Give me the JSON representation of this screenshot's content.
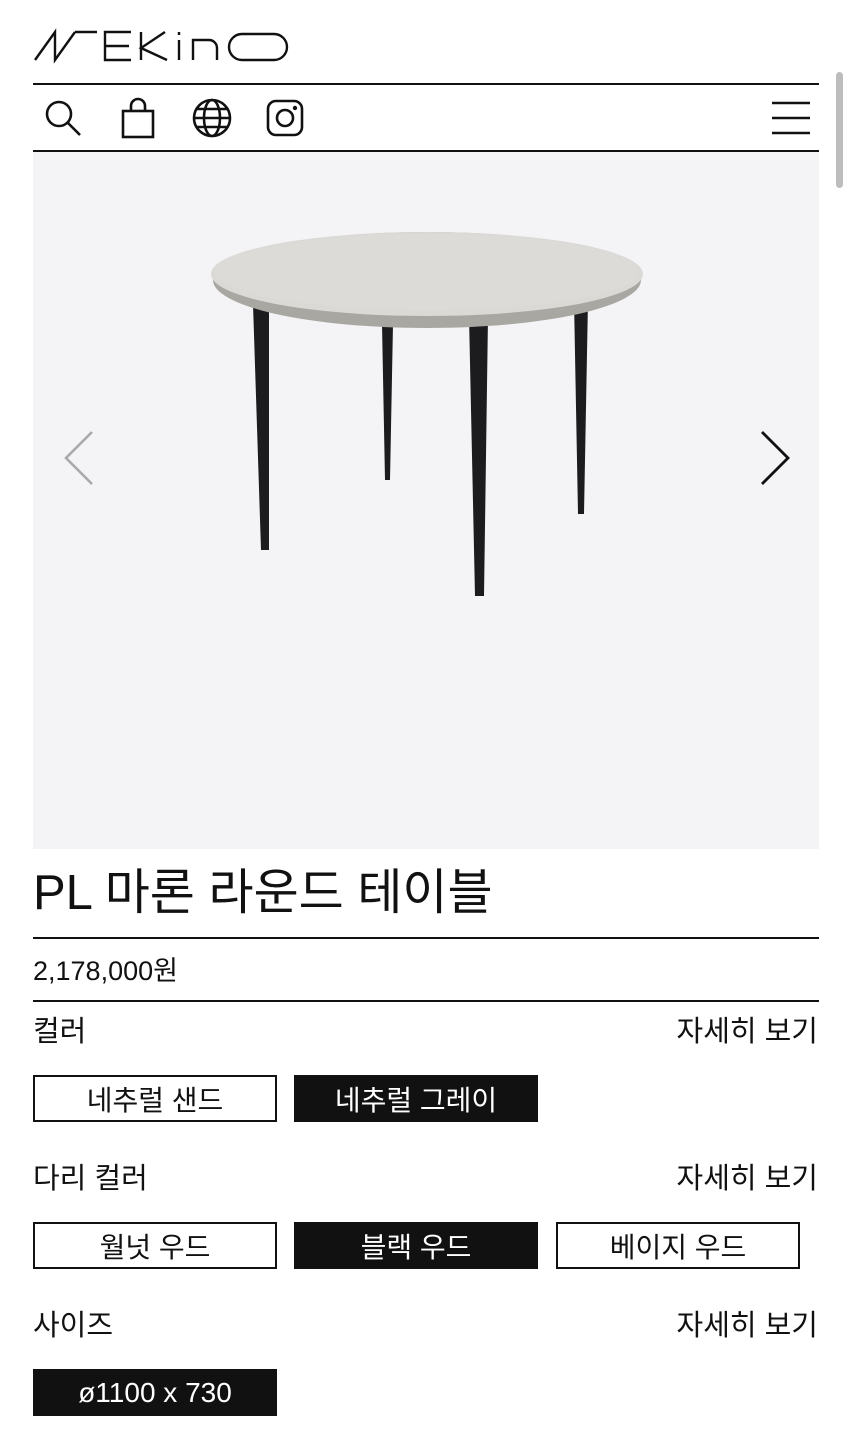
{
  "header": {
    "brand": "WEKINO",
    "icons": [
      "search-icon",
      "shopping-bag-icon",
      "globe-icon",
      "instagram-icon",
      "menu-icon"
    ]
  },
  "gallery": {
    "image_alt": "PL 마론 라운드 테이블",
    "prev_icon": "chevron-left-icon",
    "next_icon": "chevron-right-icon"
  },
  "product": {
    "title": "PL 마론 라운드 테이블",
    "price": "2,178,000원"
  },
  "options": {
    "color": {
      "label": "컬러",
      "more": "자세히 보기",
      "choices": [
        {
          "label": "네추럴 샌드",
          "selected": false
        },
        {
          "label": "네추럴 그레이",
          "selected": true
        }
      ]
    },
    "leg_color": {
      "label": "다리 컬러",
      "more": "자세히 보기",
      "choices": [
        {
          "label": "월넛 우드",
          "selected": false
        },
        {
          "label": "블랙 우드",
          "selected": true
        },
        {
          "label": "베이지 우드",
          "selected": false
        }
      ]
    },
    "size": {
      "label": "사이즈",
      "more": "자세히 보기",
      "choices": [
        {
          "label": "ø1100 x 730",
          "selected": true
        }
      ]
    }
  },
  "colors": {
    "ink": "#111111",
    "gallery_bg": "#f4f4f7",
    "tabletop": "#d9d8d4",
    "legs": "#1c1c1e"
  }
}
